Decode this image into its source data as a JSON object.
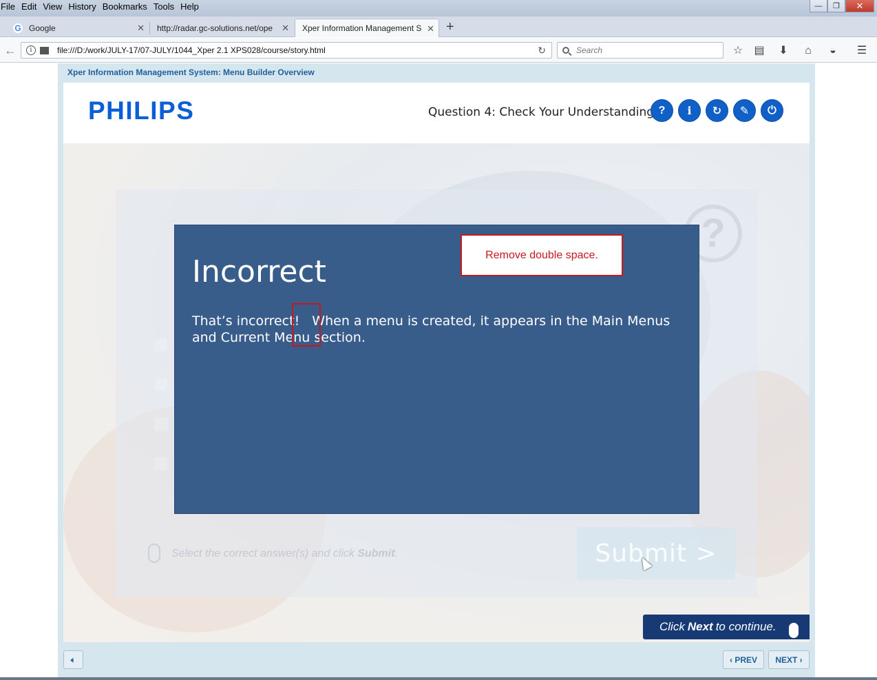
{
  "browser": {
    "menu": [
      "File",
      "Edit",
      "View",
      "History",
      "Bookmarks",
      "Tools",
      "Help"
    ],
    "tabs": [
      {
        "label": "Google"
      },
      {
        "label": "http://radar.gc-solutions.net/ope"
      },
      {
        "label": "Xper Information Management S"
      }
    ],
    "url": "file:///D:/work/JULY-17/07-JULY/1044_Xper 2.1 XPS028/course/story.html",
    "search_placeholder": "Search"
  },
  "player": {
    "title": "Xper Information Management System: Menu Builder Overview",
    "logo": "PHILIPS",
    "question_title": "Question 4: Check Your Understanding",
    "header_buttons": [
      "?",
      "i",
      "↻",
      "✎",
      "⏻"
    ],
    "instruction_prefix": "Select the correct answer(s) and click ",
    "instruction_emph": "Submit",
    "instruction_suffix": ".",
    "submit_label": "Submit  >",
    "continue_prefix": "Click ",
    "continue_emph": "Next",
    "continue_suffix": " to continue.",
    "prev_label": "PREV",
    "next_label": "NEXT"
  },
  "feedback": {
    "title": "Incorrect",
    "body": "That’s incorrect!   When a menu is created, it appears in the Main Menus\nand Current Menu section.",
    "annotation": "Remove double space."
  },
  "colors": {
    "feedback_bg": "#385d8b",
    "brand_blue": "#0b5ed7",
    "annotation_red": "#c8181e"
  }
}
